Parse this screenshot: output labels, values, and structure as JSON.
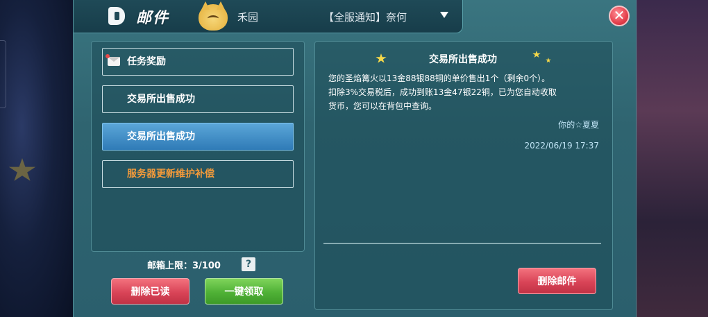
{
  "header": {
    "title": "邮件",
    "ticker_left": "禾园",
    "ticker_text": "【全服通知】奈何"
  },
  "mail_list": [
    {
      "label": "任务奖励",
      "state": "normal",
      "has_icon": true
    },
    {
      "label": "交易所出售成功",
      "state": "normal",
      "has_icon": false
    },
    {
      "label": "交易所出售成功",
      "state": "selected",
      "has_icon": false
    },
    {
      "label": "服务器更新维护补偿",
      "state": "highlight",
      "has_icon": false
    }
  ],
  "quota": {
    "label": "邮箱上限：3/100",
    "help": "?"
  },
  "buttons": {
    "delete_read": "删除已读",
    "claim_all": "一键领取",
    "delete_mail": "删除邮件"
  },
  "detail": {
    "title": "交易所出售成功",
    "body_lines": [
      "您的圣焰篝火以13金88银88铜的单价售出1个（剩余0个）。",
      "扣除3%交易税后，成功到账13金47银22铜，已为您自动收取",
      "货币，您可以在背包中查询。"
    ],
    "sender": "你的☆夏夏",
    "date": "2022/06/19 17:37"
  },
  "close": "✕",
  "colors": {
    "panel": "#2f6470",
    "selected": "#2f7bb7",
    "highlight_text": "#f39a3a",
    "red_button": "#d94457",
    "green_button": "#4fb136"
  }
}
